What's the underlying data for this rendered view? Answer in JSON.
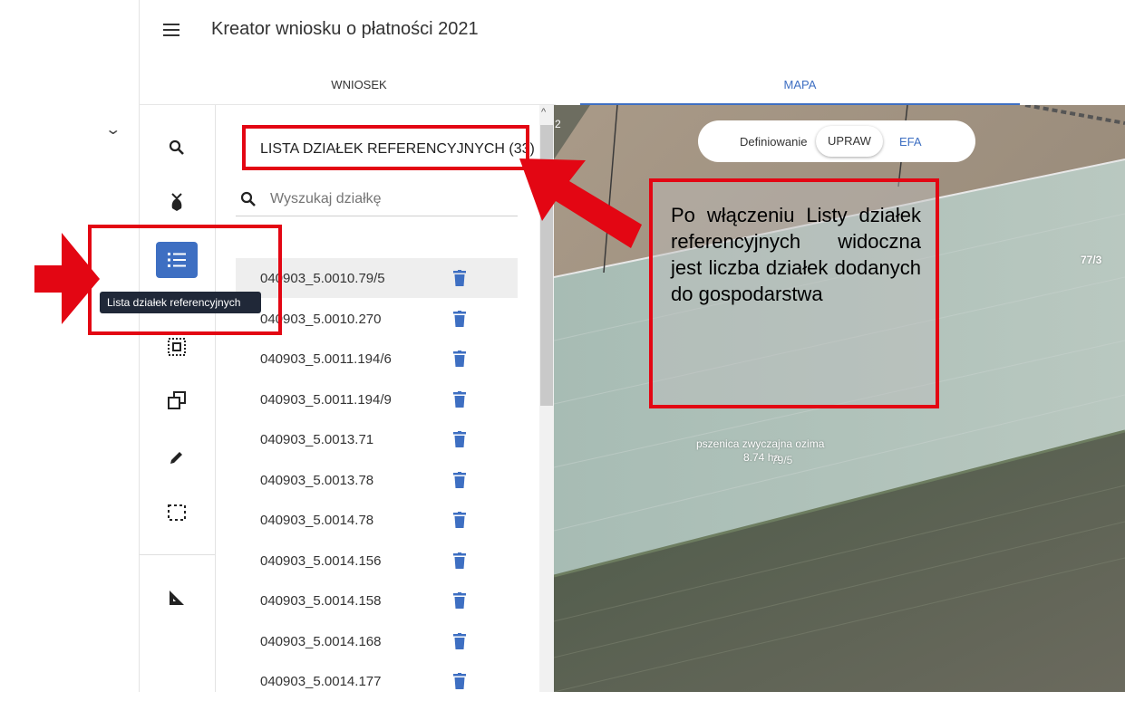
{
  "header": {
    "title": "Kreator wniosku o płatności 2021",
    "tabs": [
      {
        "label": "WNIOSEK",
        "active": false
      },
      {
        "label": "MAPA",
        "active": true
      }
    ]
  },
  "toolbar": {
    "tooltip": "Lista działek referencyjnych",
    "icons": [
      "search-icon",
      "crop-icon",
      "list-icon",
      "select-area-icon",
      "copy-icon",
      "pencil-icon",
      "dashed-rectangle-icon",
      "measure-icon"
    ]
  },
  "list": {
    "title": "LISTA DZIAŁEK REFERENCYJNYCH (33)",
    "search_placeholder": "Wyszukaj działkę",
    "items": [
      "040903_5.0010.79/5",
      "040903_5.0010.270",
      "040903_5.0011.194/6",
      "040903_5.0011.194/9",
      "040903_5.0013.71",
      "040903_5.0013.78",
      "040903_5.0014.78",
      "040903_5.0014.156",
      "040903_5.0014.158",
      "040903_5.0014.168",
      "040903_5.0014.177"
    ]
  },
  "map": {
    "toggle_label": "Definiowanie",
    "toggle_options": [
      "UPRAW",
      "EFA"
    ],
    "selected_option": "UPRAW",
    "crop_name": "pszenica zwyczajna ozima",
    "crop_area": "8.74 ha",
    "parcel_label_center": "79/5",
    "parcel_label_right": "77/3",
    "corner_label": "2"
  },
  "annotation": {
    "callout_text": "Po włączeniu Listy działek referencyjnych widoczna jest liczba działek dodanych do gospodarstwa"
  },
  "colors": {
    "accent": "#3e6fc2",
    "annotation_red": "#e30613",
    "tooltip_bg": "#202838"
  }
}
